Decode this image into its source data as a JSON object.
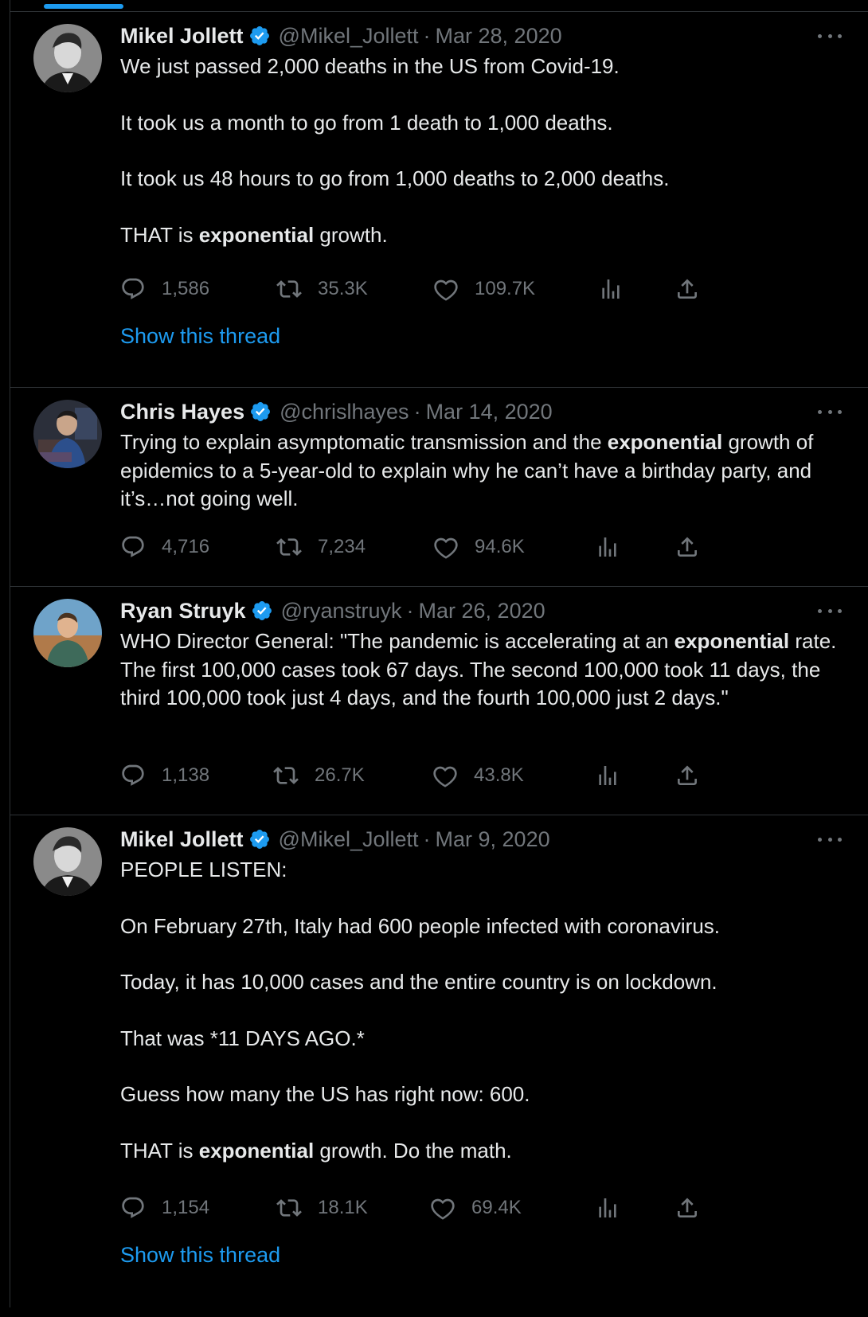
{
  "colors": {
    "background": "#000000",
    "text": "#e7e9ea",
    "secondary": "#71767b",
    "accent": "#1d9bf0",
    "divider": "#2f3336"
  },
  "tweets": [
    {
      "name": "Mikel Jollett",
      "handle": "@Mikel_Jollett",
      "separator": "·",
      "date": "Mar 28, 2020",
      "avatar_icon": "avatar-mikel-jollett",
      "paragraphs": [
        [
          "We just passed 2,000 deaths in the US from Covid-19."
        ],
        [
          "It took us a month to go from 1 death to 1,000 deaths."
        ],
        [
          "It took us 48 hours to go from 1,000 deaths to 2,000 deaths."
        ],
        [
          "THAT is ",
          "exponential",
          " growth."
        ]
      ],
      "replies": "1,586",
      "retweets": "35.3K",
      "likes": "109.7K",
      "show_thread": "Show this thread"
    },
    {
      "name": "Chris Hayes",
      "handle": "@chrislhayes",
      "separator": "·",
      "date": "Mar 14, 2020",
      "avatar_icon": "avatar-chris-hayes",
      "paragraphs": [
        [
          "Trying to explain asymptomatic transmission and the ",
          "exponential",
          " growth of epidemics to a 5-year-old to explain why he can’t have a birthday party, and it’s…not going well."
        ]
      ],
      "replies": "4,716",
      "retweets": "7,234",
      "likes": "94.6K"
    },
    {
      "name": "Ryan Struyk",
      "handle": "@ryanstruyk",
      "separator": "·",
      "date": "Mar 26, 2020",
      "avatar_icon": "avatar-ryan-struyk",
      "paragraphs": [
        [
          "WHO Director General: \"The pandemic is accelerating at an ",
          "exponential",
          " rate. The first 100,000 cases took 67 days. The second 100,000 took 11 days, the third 100,000 took just 4 days, and the fourth 100,000 just 2 days.\""
        ]
      ],
      "replies": "1,138",
      "retweets": "26.7K",
      "likes": "43.8K"
    },
    {
      "name": "Mikel Jollett",
      "handle": "@Mikel_Jollett",
      "separator": "·",
      "date": "Mar 9, 2020",
      "avatar_icon": "avatar-mikel-jollett",
      "paragraphs": [
        [
          "PEOPLE LISTEN:"
        ],
        [
          "On February 27th, Italy had 600 people infected with coronavirus."
        ],
        [
          "Today, it has 10,000 cases and the entire country is on lockdown."
        ],
        [
          "That was *11 DAYS AGO.*"
        ],
        [
          "Guess how many the US has right now: 600."
        ],
        [
          "THAT is ",
          "exponential",
          " growth. Do the math."
        ]
      ],
      "replies": "1,154",
      "retweets": "18.1K",
      "likes": "69.4K",
      "show_thread": "Show this thread"
    }
  ]
}
